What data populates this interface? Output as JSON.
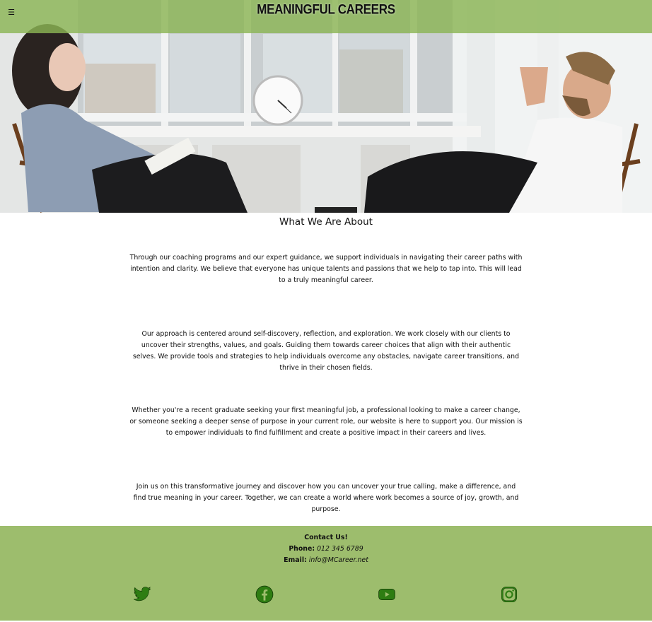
{
  "header": {
    "menu_icon": "☰",
    "title": "MEANINGFUL CAREERS"
  },
  "main": {
    "heading": "What We Are About",
    "paragraphs": [
      "Through our coaching programs and our expert guidance, we support individuals in navigating their career paths with intention and clarity. We believe that everyone has unique talents and passions that we help to tap into. This will lead to a truly meaningful career.",
      "Our approach is centered around self-discovery, reflection, and exploration. We work closely with our clients to uncover their strengths, values, and goals. Guiding them towards career choices that align with their authentic selves. We provide tools and strategies to help individuals overcome any obstacles, navigate career transitions, and thrive in their chosen fields.",
      "Whether you're a recent graduate seeking your first meaningful job, a professional looking to make a career change, or someone seeking a deeper sense of purpose in your current role, our website is here to support you. Our mission is to empower individuals to find fulfillment and create a positive impact in their careers and lives.",
      "Join us on this transformative journey and discover how you can uncover your true calling, make a difference, and find true meaning in your career. Together, we can create a world where work becomes a source of joy, growth, and purpose."
    ]
  },
  "footer": {
    "contact_heading": "Contact Us!",
    "phone_label": "Phone:",
    "phone_value": "012 345 6789",
    "email_label": "Email:",
    "email_value": "info@MCareer.net",
    "social_icons": [
      "twitter-icon",
      "facebook-icon",
      "youtube-icon",
      "instagram-icon"
    ],
    "icon_color": "#2e7d12"
  },
  "colors": {
    "header_bar": "#8bb454",
    "footer_bg": "#9dbd6d"
  }
}
